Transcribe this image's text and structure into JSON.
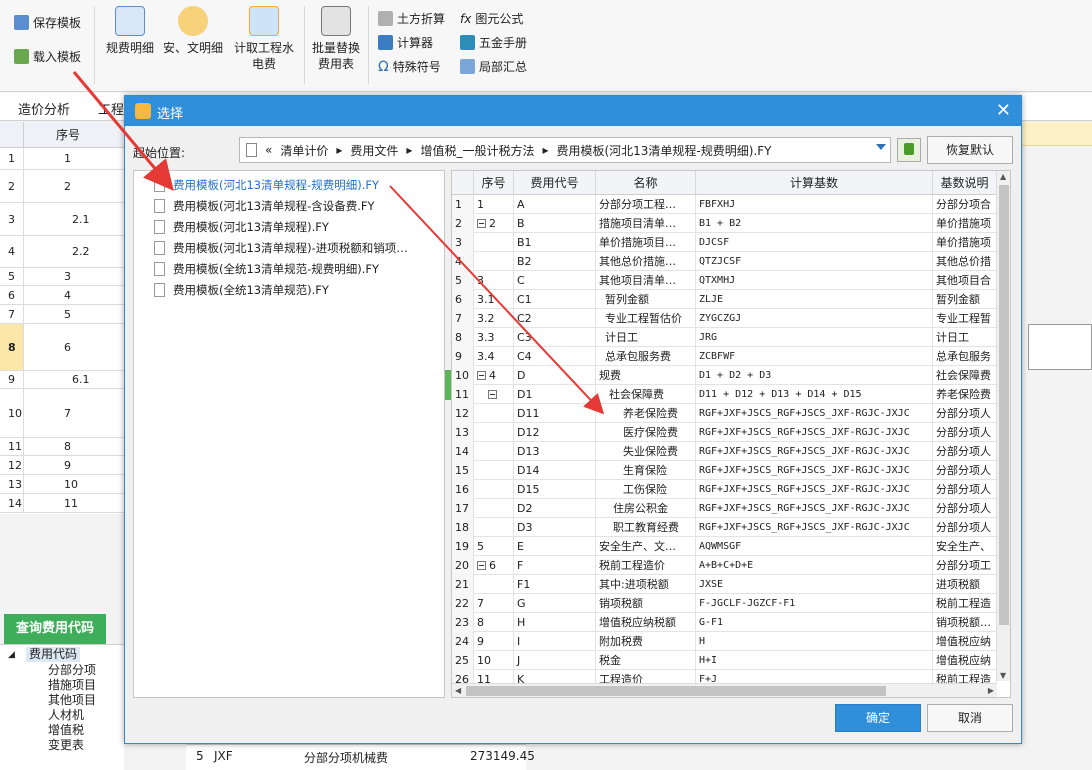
{
  "ribbon": {
    "save_template": "保存模板",
    "load_template": "载入模板",
    "fee_detail": "规费明细",
    "safety_detail": "安、文明细",
    "water_fee": "计取工程水电费",
    "batch_replace": "批量替换费用表",
    "earth_calc": "土方折算",
    "formula": "图元公式",
    "calculator": "计算器",
    "hardware_manual": "五金手册",
    "special_symbol": "特殊符号",
    "local_summary": "局部汇总"
  },
  "bg": {
    "tab1": "造价分析",
    "tab2": "工程",
    "col_seq": "序号",
    "rows": [
      "1",
      "2",
      "2.1",
      "2.2",
      "3",
      "4",
      "5",
      "6",
      "6.1",
      "7",
      "8",
      "9",
      "10",
      "11"
    ],
    "row_nums": [
      "1",
      "2",
      "3",
      "4",
      "5",
      "6",
      "7",
      "8",
      "9",
      "10",
      "11",
      "12",
      "13",
      "14"
    ],
    "query_tab": "查询费用代码",
    "tree": {
      "root": "费用代码",
      "items": [
        "分部分项",
        "措施项目",
        "其他项目",
        "人材机",
        "增值税",
        "变更表"
      ]
    },
    "bottom": {
      "num": "5",
      "code": "JXF",
      "name": "分部分项机械费",
      "value": "273149.45"
    }
  },
  "dialog": {
    "title": "选择",
    "loc_label": "起始位置:",
    "crumbs": [
      "«",
      "清单计价",
      "▸",
      "费用文件",
      "▸",
      "增值税_一般计税方法",
      "▸",
      "费用模板(河北13清单规程-规费明细).FY"
    ],
    "restore_default": "恢复默认",
    "ok": "确定",
    "cancel": "取消",
    "files": [
      "费用模板(河北13清单规程-规费明细).FY",
      "费用模板(河北13清单规程-含设备费.FY",
      "费用模板(河北13清单规程).FY",
      "费用模板(河北13清单规程)-进项税额和销项…",
      "费用模板(全统13清单规范-规费明细).FY",
      "费用模板(全统13清单规范).FY"
    ],
    "grid": {
      "headers": [
        "序号",
        "费用代号",
        "名称",
        "计算基数",
        "基数说明"
      ],
      "rows": [
        {
          "n": "1",
          "seq": "1",
          "code": "A",
          "name": "分部分项工程…",
          "base": "FBFXHJ",
          "desc": "分部分项合"
        },
        {
          "n": "2",
          "seq": "2",
          "code": "B",
          "name": "措施项目清单…",
          "base": "B1 + B2",
          "desc": "单价措施项"
        },
        {
          "n": "3",
          "seq": "",
          "code": "B1",
          "name": "单价措施项目…",
          "base": "DJCSF",
          "desc": "单价措施项"
        },
        {
          "n": "4",
          "seq": "",
          "code": "B2",
          "name": "其他总价措施…",
          "base": "QTZJCSF",
          "desc": "其他总价措"
        },
        {
          "n": "5",
          "seq": "3",
          "code": "C",
          "name": "其他项目清单…",
          "base": "QTXMHJ",
          "desc": "其他项目合"
        },
        {
          "n": "6",
          "seq": "3.1",
          "code": "C1",
          "name": "暂列金额",
          "base": "ZLJE",
          "desc": "暂列金额"
        },
        {
          "n": "7",
          "seq": "3.2",
          "code": "C2",
          "name": "专业工程暂估价",
          "base": "ZYGCZGJ",
          "desc": "专业工程暂"
        },
        {
          "n": "8",
          "seq": "3.3",
          "code": "C3",
          "name": "计日工",
          "base": "JRG",
          "desc": "计日工"
        },
        {
          "n": "9",
          "seq": "3.4",
          "code": "C4",
          "name": "总承包服务费",
          "base": "ZCBFWF",
          "desc": "总承包服务"
        },
        {
          "n": "10",
          "seq": "4",
          "code": "D",
          "name": "规费",
          "base": "D1 + D2 + D3",
          "desc": "社会保障费"
        },
        {
          "n": "11",
          "seq": "",
          "code": "D1",
          "name": "社会保障费",
          "base": "D11 + D12 + D13 + D14 + D15",
          "desc": "养老保险费"
        },
        {
          "n": "12",
          "seq": "",
          "code": "D11",
          "name": "养老保险费",
          "base": "RGF+JXF+JSCS_RGF+JSCS_JXF-RGJC-JXJC",
          "desc": "分部分项人"
        },
        {
          "n": "13",
          "seq": "",
          "code": "D12",
          "name": "医疗保险费",
          "base": "RGF+JXF+JSCS_RGF+JSCS_JXF-RGJC-JXJC",
          "desc": "分部分项人"
        },
        {
          "n": "14",
          "seq": "",
          "code": "D13",
          "name": "失业保险费",
          "base": "RGF+JXF+JSCS_RGF+JSCS_JXF-RGJC-JXJC",
          "desc": "分部分项人"
        },
        {
          "n": "15",
          "seq": "",
          "code": "D14",
          "name": "生育保险",
          "base": "RGF+JXF+JSCS_RGF+JSCS_JXF-RGJC-JXJC",
          "desc": "分部分项人"
        },
        {
          "n": "16",
          "seq": "",
          "code": "D15",
          "name": "工伤保险",
          "base": "RGF+JXF+JSCS_RGF+JSCS_JXF-RGJC-JXJC",
          "desc": "分部分项人"
        },
        {
          "n": "17",
          "seq": "",
          "code": "D2",
          "name": "住房公积金",
          "base": "RGF+JXF+JSCS_RGF+JSCS_JXF-RGJC-JXJC",
          "desc": "分部分项人"
        },
        {
          "n": "18",
          "seq": "",
          "code": "D3",
          "name": "职工教育经费",
          "base": "RGF+JXF+JSCS_RGF+JSCS_JXF-RGJC-JXJC",
          "desc": "分部分项人"
        },
        {
          "n": "19",
          "seq": "5",
          "code": "E",
          "name": "安全生产、文…",
          "base": "AQWMSGF",
          "desc": "安全生产、"
        },
        {
          "n": "20",
          "seq": "6",
          "code": "F",
          "name": "税前工程造价",
          "base": "A+B+C+D+E",
          "desc": "分部分项工"
        },
        {
          "n": "21",
          "seq": "",
          "code": "F1",
          "name": "其中:进项税额",
          "base": "JXSE",
          "desc": "进项税额"
        },
        {
          "n": "22",
          "seq": "7",
          "code": "G",
          "name": "销项税额",
          "base": "F-JGCLF-JGZCF-F1",
          "desc": "税前工程造"
        },
        {
          "n": "23",
          "seq": "8",
          "code": "H",
          "name": "增值税应纳税额",
          "base": "G-F1",
          "desc": "销项税额…"
        },
        {
          "n": "24",
          "seq": "9",
          "code": "I",
          "name": "附加税费",
          "base": "H",
          "desc": "增值税应纳"
        },
        {
          "n": "25",
          "seq": "10",
          "code": "J",
          "name": "税金",
          "base": "H+I",
          "desc": "增值税应纳"
        },
        {
          "n": "26",
          "seq": "11",
          "code": "K",
          "name": "工程造价",
          "base": "F+J",
          "desc": "税前工程造"
        }
      ]
    }
  },
  "colors": {
    "accent": "#2f8fdb",
    "green": "#3fae5a",
    "arrow": "#e53935"
  }
}
